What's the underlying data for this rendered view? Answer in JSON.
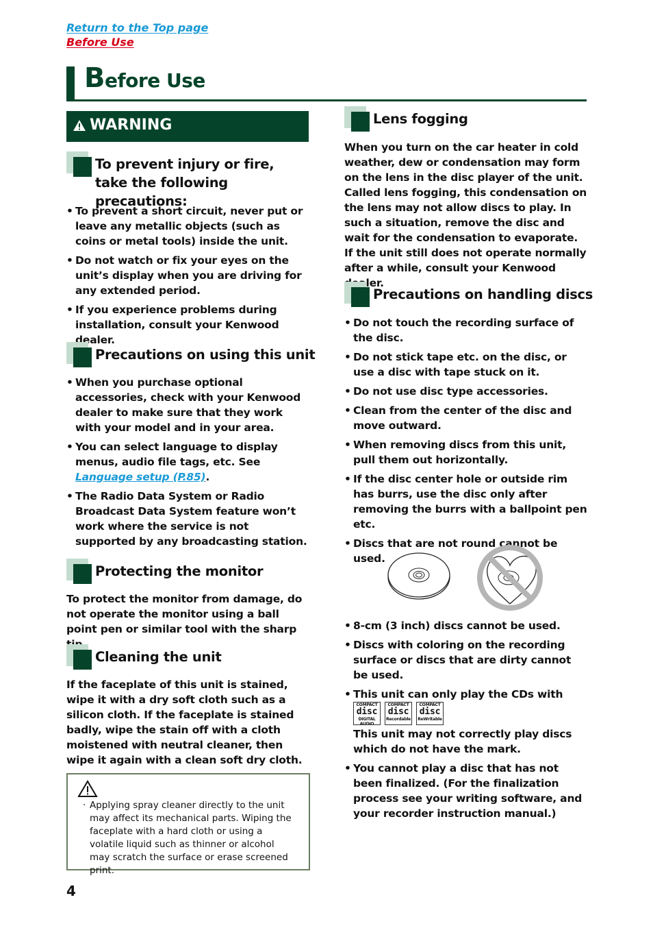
{
  "nav": {
    "return_top": "Return to the Top page",
    "before_use": "Before Use"
  },
  "header": {
    "title_first": "B",
    "title_rest": "efore Use"
  },
  "warning": {
    "label": "WARNING"
  },
  "left": {
    "injury": {
      "heading": "To prevent injury or fire, take the following precautions:",
      "items": [
        "To prevent a short circuit, never put or leave any metallic objects (such as coins or metal tools) inside the unit.",
        "Do not watch or fix your eyes on the unit’s display when you are driving for any extended period.",
        "If you experience problems during installation, consult your Kenwood dealer."
      ]
    },
    "using": {
      "heading": "Precautions on using this unit",
      "item1": "When you purchase optional accessories, check with your Kenwood dealer to make sure that they work with your model and in your area.",
      "item2_pre": "You can select language to display menus, audio file tags, etc. See ",
      "item2_link": "Language setup (P.85)",
      "item2_post": ".",
      "item3": "The Radio Data System or Radio Broadcast Data System feature won’t work where the service is not supported by any broadcasting station."
    },
    "monitor": {
      "heading": "Protecting the monitor",
      "text": "To protect the monitor from damage, do not operate the monitor using a ball point pen or similar tool with the sharp tip."
    },
    "cleaning": {
      "heading": "Cleaning the unit",
      "text": "If the faceplate of this unit is stained, wipe it with a dry soft cloth such as a silicon cloth. If the faceplate is stained badly, wipe the stain off with a cloth moistened with neutral cleaner, then wipe it again with a clean soft dry cloth."
    },
    "caution": {
      "text": "Applying spray cleaner directly to the unit may affect its mechanical parts. Wiping the faceplate with a hard cloth or using a volatile liquid such as thinner or alcohol may scratch the surface or erase screened print."
    }
  },
  "right": {
    "lens": {
      "heading": "Lens fogging",
      "text": "When you turn on the car heater in cold weather, dew or condensation may form on the lens in the disc player of the unit. Called lens fogging, this condensation on the lens may not allow discs to play. In such a situation, remove the disc and wait for the condensation to evaporate. If the unit still does not operate normally after a while, consult your Kenwood dealer."
    },
    "discs": {
      "heading": "Precautions on handling discs",
      "items": [
        "Do not touch the recording surface of the disc.",
        "Do not stick tape etc. on the disc, or use a disc with tape stuck on it.",
        "Do not use disc type accessories.",
        "Clean from the center of the disc and move outward.",
        "When removing discs from this unit, pull them out horizontally.",
        "If the disc center hole or outside rim has burrs, use the disc only after removing the burrs with a ballpoint pen etc.",
        "Discs that are not round cannot be used."
      ],
      "items2": [
        "8-cm (3 inch) discs cannot be used.",
        "Discs with coloring on the recording surface or discs that are dirty cannot be used."
      ],
      "cd_item": "This unit can only play the CDs with",
      "cd_note": "This unit may not correctly play discs which do not have the mark.",
      "logos": [
        {
          "top": "COMPACT",
          "mid": "disc",
          "bottom": "DIGITAL AUDIO"
        },
        {
          "top": "COMPACT",
          "mid": "disc",
          "bottom": "Recordable"
        },
        {
          "top": "COMPACT",
          "mid": "disc",
          "bottom": "ReWritable"
        }
      ],
      "final_item": "You cannot play a disc that has not been finalized. (For the finalization process see your writing software, and your recorder instruction manual.)"
    }
  },
  "footer": {
    "page_number": "4"
  }
}
